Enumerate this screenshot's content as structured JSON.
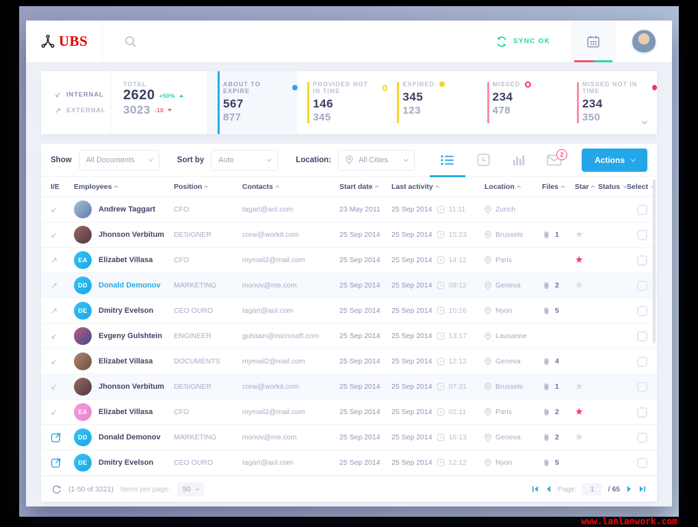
{
  "header": {
    "logo_text": "UBS",
    "sync_label": "SYNC OK"
  },
  "colors": {
    "accent_blue": "#23a7e8",
    "brand_red": "#e60100",
    "teal": "#2bd3a6",
    "star_red": "#f5365c",
    "status": {
      "blue": "#1da8f0",
      "green": "#2de06a",
      "yellow": "#f6d620",
      "pink": "#f5365c"
    }
  },
  "stats": {
    "internal_label": "INTERNAL",
    "external_label": "EXTERNAL",
    "total": {
      "label": "TOTAL",
      "internal": "2620",
      "internal_delta": "+50%",
      "external": "3023",
      "external_delta": "-10"
    },
    "cards": [
      {
        "label": "ABOUT TO EXPIRE",
        "dot": "#29aae1",
        "dot_filled": true,
        "accent": "#29aae1",
        "internal": "567",
        "external": "877",
        "active": true
      },
      {
        "label": "PROVIDED NOT IN TIME",
        "dot": "#f6d620",
        "dot_filled": false,
        "accent": "#f6d620",
        "internal": "146",
        "external": "345",
        "active": false
      },
      {
        "label": "EXPIRED",
        "dot": "#f6d620",
        "dot_filled": true,
        "accent": "#f6d620",
        "internal": "345",
        "external": "123",
        "active": false
      },
      {
        "label": "MISSED",
        "dot": "#f5365c",
        "dot_filled": false,
        "accent": "#f98da6",
        "internal": "234",
        "external": "478",
        "active": false
      },
      {
        "label": "MISSED NOT IN TIME",
        "dot": "#f5365c",
        "dot_filled": true,
        "accent": "#f98da6",
        "internal": "234",
        "external": "350",
        "active": false
      }
    ]
  },
  "toolbar": {
    "show_label": "Show",
    "show_value": "All Documents",
    "sort_label": "Sort by",
    "sort_value": "Auto",
    "location_label": "Location:",
    "location_value": "All Cities",
    "mail_badge": "2",
    "actions_label": "Actions"
  },
  "table": {
    "columns": [
      {
        "label": "I/E",
        "sort": ""
      },
      {
        "label": "Employees",
        "sort": "up"
      },
      {
        "label": "Position",
        "sort": "up"
      },
      {
        "label": "Contacts",
        "sort": "up"
      },
      {
        "label": "Start date",
        "sort": "up"
      },
      {
        "label": "Last activity",
        "sort": "up"
      },
      {
        "label": "Location",
        "sort": "up"
      },
      {
        "label": "Files",
        "sort": "up"
      },
      {
        "label": "Star",
        "sort": "up"
      },
      {
        "label": "Status",
        "sort": "down"
      },
      {
        "label": "Select",
        "sort": "down"
      }
    ],
    "rows": [
      {
        "ie": "in",
        "avatar": {
          "kind": "photo",
          "c1": "#aabdd6",
          "c2": "#5d7cab"
        },
        "name": "Andrew Taggart",
        "name_accent": false,
        "position": "CFO",
        "contact": "tagart@aol.com",
        "start_date": "23 May 2011",
        "activity_date": "25 Sep 2014",
        "activity_time": "11:11",
        "location": "Zurich",
        "files": "",
        "star": "",
        "status": "blue",
        "highlight": false
      },
      {
        "ie": "in",
        "avatar": {
          "kind": "photo",
          "c1": "#9a6b5f",
          "c2": "#51344a"
        },
        "name": "Jhonson Verbitum",
        "name_accent": false,
        "position": "DESIGNER",
        "contact": "crew@workit.com",
        "start_date": "25 Sep 2014",
        "activity_date": "25 Sep 2014",
        "activity_time": "15:23",
        "location": "Brussels",
        "files": "1",
        "star": "outline",
        "status": "blue",
        "highlight": false
      },
      {
        "ie": "out",
        "avatar": {
          "kind": "initials",
          "text": "EA",
          "c1": "#35c2f1",
          "c2": "#18a8e8"
        },
        "name": "Elizabet Villasa",
        "name_accent": false,
        "position": "CFO",
        "contact": "mymail2@mail.com",
        "start_date": "25 Sep 2014",
        "activity_date": "25 Sep 2014",
        "activity_time": "14:12",
        "location": "Paris",
        "files": "",
        "star": "filled",
        "status": "blue",
        "highlight": false
      },
      {
        "ie": "out",
        "avatar": {
          "kind": "initials",
          "text": "DD",
          "c1": "#35c2f1",
          "c2": "#18a8e8"
        },
        "name": "Donald Demonov",
        "name_accent": true,
        "position": "MARKETING",
        "contact": "monov@me.com",
        "start_date": "25 Sep 2014",
        "activity_date": "25 Sep 2014",
        "activity_time": "09:12",
        "location": "Geneva",
        "files": "2",
        "star": "outline",
        "status": "blue",
        "highlight": true
      },
      {
        "ie": "out",
        "avatar": {
          "kind": "initials",
          "text": "DE",
          "c1": "#35c2f1",
          "c2": "#18a8e8"
        },
        "name": "Dmitry Evelson",
        "name_accent": false,
        "position": "CEO OURO",
        "contact": "tagart@aol.com",
        "start_date": "25 Sep 2014",
        "activity_date": "25 Sep 2014",
        "activity_time": "10:16",
        "location": "Nyon",
        "files": "5",
        "star": "",
        "status": "green",
        "highlight": false
      },
      {
        "ie": "in",
        "avatar": {
          "kind": "photo",
          "c1": "#c05c7e",
          "c2": "#3b4b8c"
        },
        "name": "Evgeny Gulshtein",
        "name_accent": false,
        "position": "ENGINEER",
        "contact": "gulstain@microsoft.com",
        "start_date": "25 Sep 2014",
        "activity_date": "25 Sep 2014",
        "activity_time": "13:17",
        "location": "Lausanne",
        "files": "",
        "star": "",
        "status": "yellow",
        "highlight": false
      },
      {
        "ie": "in",
        "avatar": {
          "kind": "photo",
          "c1": "#b0896b",
          "c2": "#6d4c41"
        },
        "name": "Elizabet Villasa",
        "name_accent": false,
        "position": "DOCUMENTS",
        "contact": "mymail2@mail.com",
        "start_date": "25 Sep 2014",
        "activity_date": "25 Sep 2014",
        "activity_time": "12:12",
        "location": "Geneva",
        "files": "4",
        "star": "",
        "status": "pink",
        "highlight": false
      },
      {
        "ie": "in",
        "avatar": {
          "kind": "photo",
          "c1": "#9a6b5f",
          "c2": "#51344a"
        },
        "name": "Jhonson Verbitum",
        "name_accent": false,
        "position": "DESIGNER",
        "contact": "crew@workit.com",
        "start_date": "25 Sep 2014",
        "activity_date": "25 Sep 2014",
        "activity_time": "07:31",
        "location": "Brussels",
        "files": "1",
        "star": "outline",
        "status": "blue",
        "highlight": true
      },
      {
        "ie": "in",
        "avatar": {
          "kind": "initials",
          "text": "EA",
          "c1": "#f59bd8",
          "c2": "#ee82cd"
        },
        "name": "Elizabet Villasa",
        "name_accent": false,
        "position": "CFO",
        "contact": "mymail2@mail.com",
        "start_date": "25 Sep 2014",
        "activity_date": "25 Sep 2014",
        "activity_time": "02:11",
        "location": "Paris",
        "files": "2",
        "star": "filled",
        "status": "",
        "highlight": false
      },
      {
        "ie": "box",
        "avatar": {
          "kind": "initials",
          "text": "DD",
          "c1": "#35c2f1",
          "c2": "#18a8e8"
        },
        "name": "Donald Demonov",
        "name_accent": false,
        "position": "MARKETING",
        "contact": "monov@me.com",
        "start_date": "25 Sep 2014",
        "activity_date": "25 Sep 2014",
        "activity_time": "16:13",
        "location": "Geneva",
        "files": "2",
        "star": "outline",
        "status": "blue",
        "highlight": false
      },
      {
        "ie": "box",
        "avatar": {
          "kind": "initials",
          "text": "DE",
          "c1": "#35c2f1",
          "c2": "#18a8e8"
        },
        "name": "Dmitry Evelson",
        "name_accent": false,
        "position": "CEO OURO",
        "contact": "tagart@aol.com",
        "start_date": "25 Sep 2014",
        "activity_date": "25 Sep 2014",
        "activity_time": "12:12",
        "location": "Nyon",
        "files": "5",
        "star": "",
        "status": "green",
        "highlight": false
      }
    ]
  },
  "footer": {
    "range": "(1-50 of 3221)",
    "items_per_page_label": "Items per page:",
    "items_per_page_value": "50",
    "page_label": "Page:",
    "page_value": "1",
    "page_total": "/ 65"
  },
  "watermark": "www.lanlanwork.com"
}
